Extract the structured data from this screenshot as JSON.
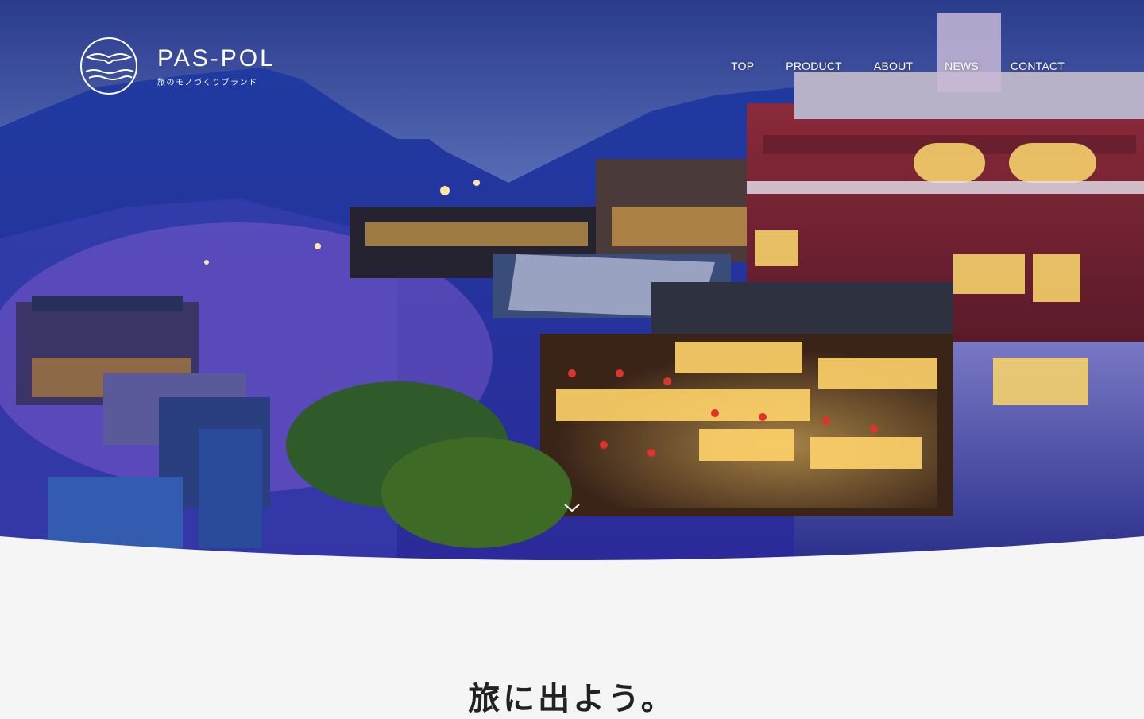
{
  "brand": {
    "name": "PAS-POL",
    "tagline": "旅のモノづくりブランド",
    "logo_icon": "bird-wave-circle-icon"
  },
  "nav": {
    "items": [
      {
        "label": "TOP"
      },
      {
        "label": "PRODUCT"
      },
      {
        "label": "ABOUT"
      },
      {
        "label": "NEWS"
      },
      {
        "label": "CONTACT"
      }
    ]
  },
  "hero": {
    "scroll_icon": "chevron-down-icon",
    "background_color": "#f5f5f5"
  },
  "main": {
    "headline": "旅に出よう。"
  }
}
